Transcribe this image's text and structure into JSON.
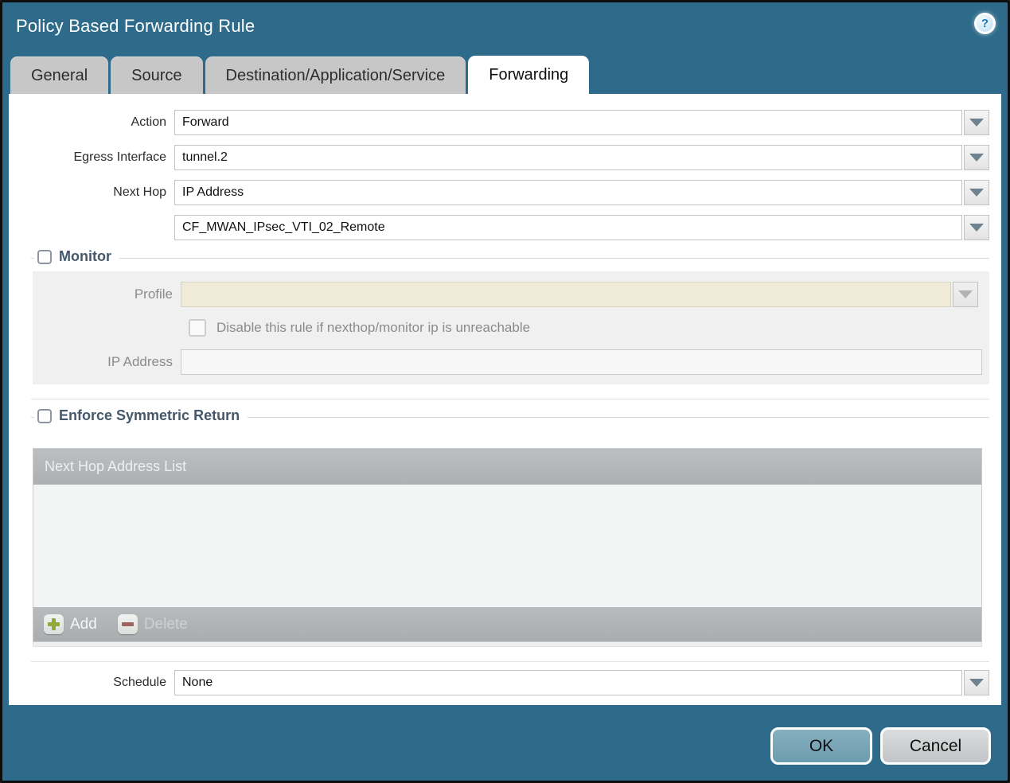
{
  "window": {
    "title": "Policy Based Forwarding Rule",
    "help_icon": "question-mark"
  },
  "tabs": [
    {
      "label": "General",
      "active": false
    },
    {
      "label": "Source",
      "active": false
    },
    {
      "label": "Destination/Application/Service",
      "active": false
    },
    {
      "label": "Forwarding",
      "active": true
    }
  ],
  "form": {
    "action": {
      "label": "Action",
      "value": "Forward"
    },
    "egress_interface": {
      "label": "Egress Interface",
      "value": "tunnel.2"
    },
    "next_hop": {
      "label": "Next Hop",
      "value": "IP Address"
    },
    "next_hop_address": {
      "label": "",
      "value": "CF_MWAN_IPsec_VTI_02_Remote"
    },
    "schedule": {
      "label": "Schedule",
      "value": "None"
    }
  },
  "monitor": {
    "legend": "Monitor",
    "checked": false,
    "profile": {
      "label": "Profile",
      "value": ""
    },
    "disable_rule": {
      "label": "Disable this rule if nexthop/monitor ip is unreachable",
      "checked": false
    },
    "ip_address": {
      "label": "IP Address",
      "value": ""
    }
  },
  "enforce_symmetric_return": {
    "legend": "Enforce Symmetric Return",
    "checked": false,
    "table": {
      "header": "Next Hop Address List",
      "rows": []
    },
    "add_label": "Add",
    "delete_label": "Delete",
    "delete_enabled": false
  },
  "footer": {
    "ok_label": "OK",
    "cancel_label": "Cancel"
  },
  "colors": {
    "titlebar_teal": "#2e6b8a",
    "active_tab": "#ffffff",
    "inactive_tab": "#c7c7c7",
    "legend_text": "#44576b",
    "disabled_field_beige": "#f0ead9",
    "disabled_area_gray": "#f0f0f0",
    "table_header_gray": "#b4b7b9",
    "ok_button_blue": "#6d9cb0",
    "cancel_button_gray": "#c2c5c7",
    "add_plus_green": "#92a83d",
    "delete_minus_red": "#a2615c"
  }
}
